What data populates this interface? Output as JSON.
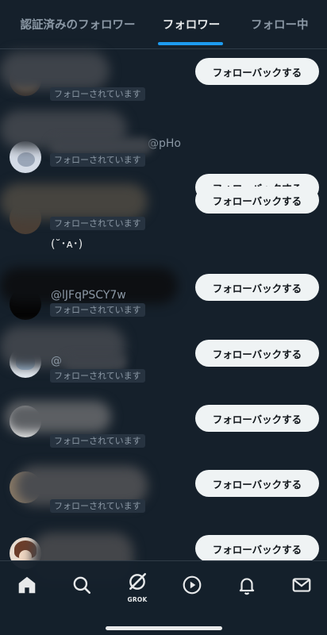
{
  "tabs": [
    {
      "label": "認証済みのフォロワー",
      "active": false
    },
    {
      "label": "フォロワー",
      "active": true
    },
    {
      "label": "フォロー中",
      "active": false
    }
  ],
  "colors": {
    "background": "#15202b",
    "accent": "#1d9bf0",
    "button_bg": "#eff3f4",
    "button_text": "#0f1419",
    "muted": "#8b98a5"
  },
  "followers": [
    {
      "handle": "",
      "follows_you": "フォローされています",
      "bio": "",
      "button": "フォローバックする"
    },
    {
      "handle": "@pHo",
      "follows_you": "フォローされています",
      "bio": "",
      "button": "フォローバックする"
    },
    {
      "handle": "",
      "follows_you": "フォローされています",
      "bio": "(˘･ᴀ･)",
      "button": "フォローバックする"
    },
    {
      "handle": "@lJFqPSCY7w",
      "follows_you": "フォローされています",
      "bio": "",
      "button": "フォローバックする"
    },
    {
      "handle": "@",
      "follows_you": "フォローされています",
      "bio": "",
      "button": "フォローバックする"
    },
    {
      "handle": "",
      "follows_you": "フォローされています",
      "bio": "",
      "button": "フォローバックする"
    },
    {
      "handle": "",
      "follows_you": "フォローされています",
      "bio": "",
      "button": "フォローバックする"
    },
    {
      "handle": "",
      "follows_you": "",
      "bio": "",
      "button": "フォローバックする"
    }
  ],
  "bottom_nav": {
    "items": [
      {
        "icon": "home-icon",
        "active": true
      },
      {
        "icon": "search-icon",
        "active": false
      },
      {
        "icon": "grok-icon",
        "label": "GROK",
        "active": false
      },
      {
        "icon": "video-play-icon",
        "active": false
      },
      {
        "icon": "bell-icon",
        "active": false
      },
      {
        "icon": "mail-icon",
        "active": false
      }
    ]
  }
}
